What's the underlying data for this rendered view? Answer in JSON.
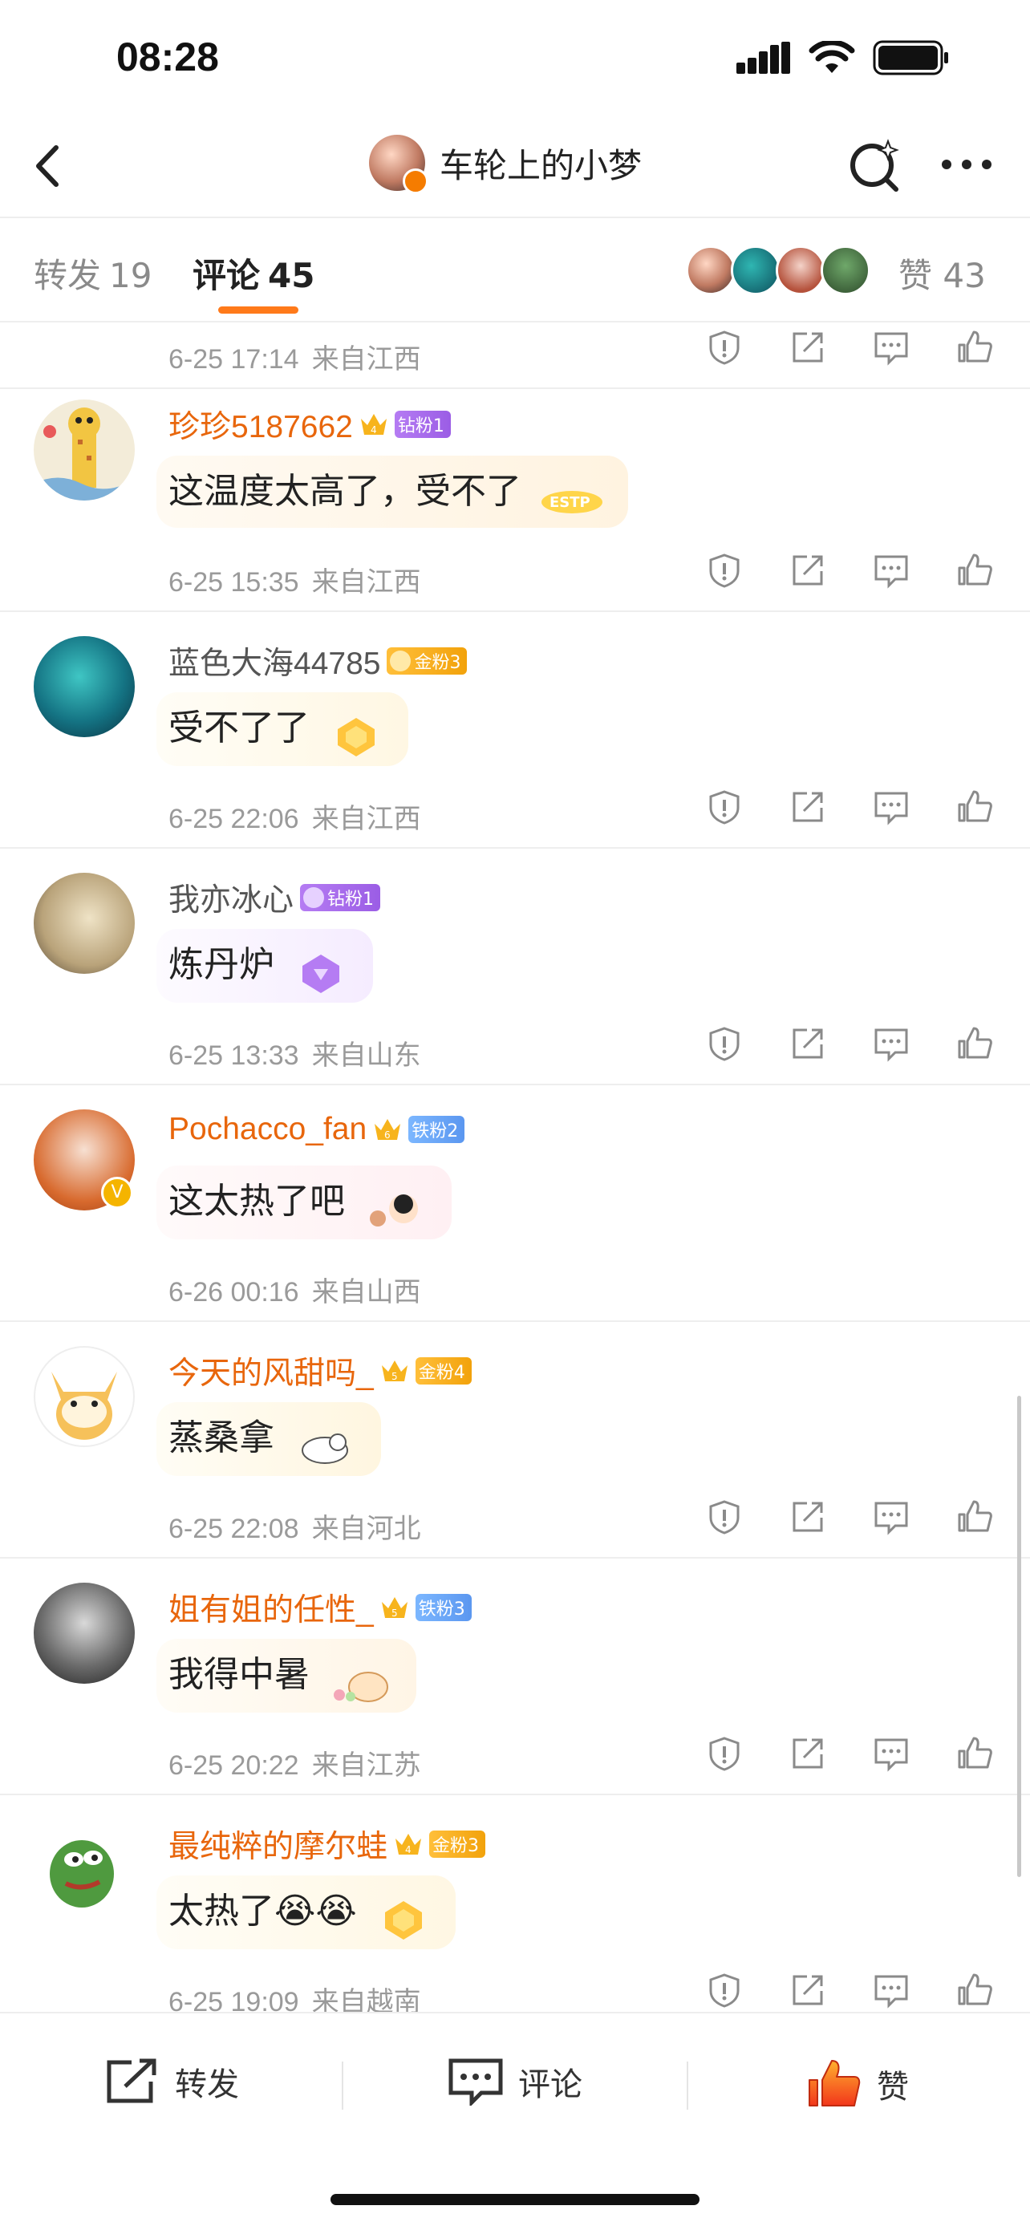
{
  "status": {
    "time": "08:28"
  },
  "nav": {
    "title": "车轮上的小梦"
  },
  "tabs": {
    "repost_label": "转发",
    "repost_count": "19",
    "comment_label": "评论",
    "comment_count": "45",
    "like_label": "赞",
    "like_count": "43"
  },
  "partial_comment": {
    "date": "6-25 17:14",
    "location": "来自江西"
  },
  "comments": [
    {
      "name": "珍珍5187662",
      "badge": "钻粉1",
      "badge_level": "4",
      "text": "这温度太高了，受不了",
      "date": "6-25 15:35",
      "location": "来自江西",
      "sticker": "ESTP"
    },
    {
      "name": "蓝色大海44785",
      "badge": "金粉3",
      "text": "受不了了",
      "date": "6-25 22:06",
      "location": "来自江西"
    },
    {
      "name": "我亦冰心",
      "badge": "钻粉1",
      "text": "炼丹炉",
      "date": "6-25 13:33",
      "location": "来自山东"
    },
    {
      "name": "Pochacco_fan",
      "badge": "铁粉2",
      "badge_level": "6",
      "text": "这太热了吧",
      "date": "6-26 00:16",
      "location": "来自山西"
    },
    {
      "name": "今天的风甜吗_",
      "badge": "金粉4",
      "badge_level": "5",
      "text": "蒸桑拿",
      "date": "6-25 22:08",
      "location": "来自河北"
    },
    {
      "name": "姐有姐的任性_",
      "badge": "铁粉3",
      "badge_level": "5",
      "text": "我得中暑",
      "date": "6-25 20:22",
      "location": "来自江苏"
    },
    {
      "name": "最纯粹的摩尔蛙",
      "badge": "金粉3",
      "badge_level": "4",
      "text": "太热了😭😭",
      "date": "6-25 19:09",
      "location": "来自越南"
    }
  ],
  "bottom": {
    "repost": "转发",
    "comment": "评论",
    "like": "赞"
  },
  "colors": {
    "accent": "#ff7a1a",
    "orange_name": "#e8660c",
    "meta": "#9a9a9a"
  },
  "icons": [
    "back-icon",
    "ai-search-icon",
    "more-icon",
    "report-icon",
    "share-icon",
    "comment-icon",
    "like-icon"
  ]
}
